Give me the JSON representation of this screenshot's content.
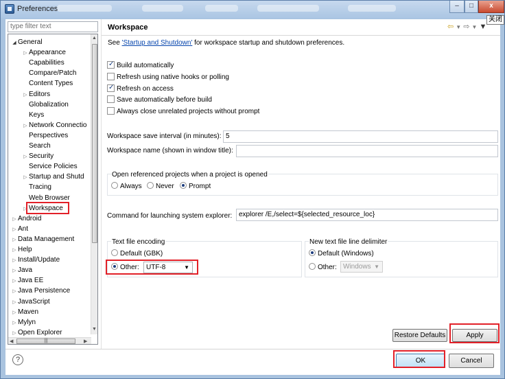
{
  "window": {
    "title": "Preferences",
    "close_label": "x",
    "tooltip": "关闭"
  },
  "filter": {
    "placeholder": "type filter text"
  },
  "tree": {
    "items": [
      {
        "label": "General",
        "level": 0,
        "arrow": "open"
      },
      {
        "label": "Appearance",
        "level": 1,
        "arrow": "closed"
      },
      {
        "label": "Capabilities",
        "level": 1,
        "arrow": ""
      },
      {
        "label": "Compare/Patch",
        "level": 1,
        "arrow": ""
      },
      {
        "label": "Content Types",
        "level": 1,
        "arrow": ""
      },
      {
        "label": "Editors",
        "level": 1,
        "arrow": "closed"
      },
      {
        "label": "Globalization",
        "level": 1,
        "arrow": ""
      },
      {
        "label": "Keys",
        "level": 1,
        "arrow": ""
      },
      {
        "label": "Network Connectio",
        "level": 1,
        "arrow": "closed"
      },
      {
        "label": "Perspectives",
        "level": 1,
        "arrow": ""
      },
      {
        "label": "Search",
        "level": 1,
        "arrow": ""
      },
      {
        "label": "Security",
        "level": 1,
        "arrow": "closed"
      },
      {
        "label": "Service Policies",
        "level": 1,
        "arrow": ""
      },
      {
        "label": "Startup and Shutd",
        "level": 1,
        "arrow": "closed"
      },
      {
        "label": "Tracing",
        "level": 1,
        "arrow": ""
      },
      {
        "label": "Web Browser",
        "level": 1,
        "arrow": ""
      },
      {
        "label": "Workspace",
        "level": 1,
        "arrow": "closed",
        "selected": true
      },
      {
        "label": "Android",
        "level": 0,
        "arrow": "closed"
      },
      {
        "label": "Ant",
        "level": 0,
        "arrow": "closed"
      },
      {
        "label": "Data Management",
        "level": 0,
        "arrow": "closed"
      },
      {
        "label": "Help",
        "level": 0,
        "arrow": "closed"
      },
      {
        "label": "Install/Update",
        "level": 0,
        "arrow": "closed"
      },
      {
        "label": "Java",
        "level": 0,
        "arrow": "closed"
      },
      {
        "label": "Java EE",
        "level": 0,
        "arrow": "closed"
      },
      {
        "label": "Java Persistence",
        "level": 0,
        "arrow": "closed"
      },
      {
        "label": "JavaScript",
        "level": 0,
        "arrow": "closed"
      },
      {
        "label": "Maven",
        "level": 0,
        "arrow": "closed"
      },
      {
        "label": "Mylyn",
        "level": 0,
        "arrow": "closed"
      },
      {
        "label": "Open Explorer",
        "level": 0,
        "arrow": "closed"
      }
    ]
  },
  "page": {
    "title": "Workspace",
    "desc_prefix": "See ",
    "desc_link": "'Startup and Shutdown'",
    "desc_suffix": " for workspace startup and shutdown preferences.",
    "checkboxes": [
      {
        "label": "Build automatically",
        "checked": true
      },
      {
        "label": "Refresh using native hooks or polling",
        "checked": false
      },
      {
        "label": "Refresh on access",
        "checked": true
      },
      {
        "label": "Save automatically before build",
        "checked": false
      },
      {
        "label": "Always close unrelated projects without prompt",
        "checked": false
      }
    ],
    "save_interval_label": "Workspace save interval (in minutes):",
    "save_interval_value": "5",
    "ws_name_label": "Workspace name (shown in window title):",
    "ws_name_value": "",
    "open_ref": {
      "legend": "Open referenced projects when a project is opened",
      "options": [
        "Always",
        "Never",
        "Prompt"
      ],
      "selected": "Prompt"
    },
    "cmd_label": "Command for launching system explorer:",
    "cmd_value": "explorer /E,/select=${selected_resource_loc}",
    "encoding": {
      "legend": "Text file encoding",
      "default_label": "Default (GBK)",
      "other_label": "Other:",
      "other_value": "UTF-8",
      "selected": "Other"
    },
    "line_delim": {
      "legend": "New text file line delimiter",
      "default_label": "Default (Windows)",
      "other_label": "Other:",
      "other_value": "Windows",
      "selected": "Default"
    },
    "restore_defaults": "Restore Defaults",
    "apply": "Apply"
  },
  "footer": {
    "ok": "OK",
    "cancel": "Cancel",
    "help": "?"
  },
  "colors": {
    "highlight": "#e22028",
    "link": "#0645ad",
    "titlebar": "#aac5e3"
  }
}
